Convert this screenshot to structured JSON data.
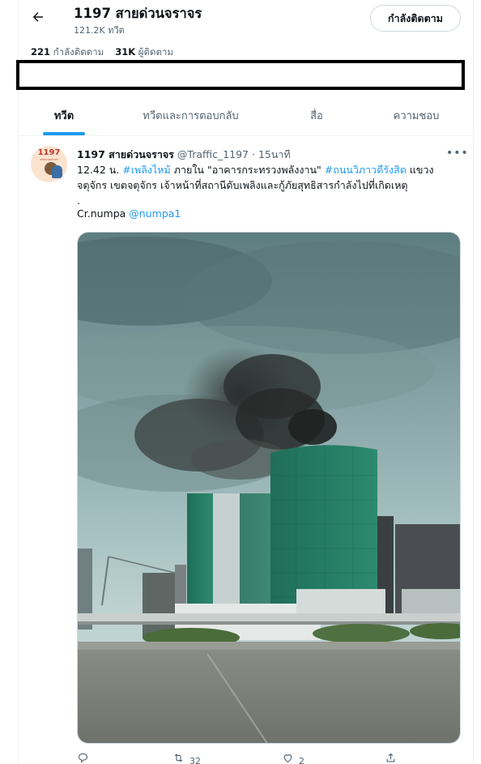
{
  "header": {
    "title": "1197 สายด่วนจราจร",
    "subtitle": "121.2K ทวีต",
    "follow_label": "กำลังติดตาม"
  },
  "stats": {
    "following_count": "221",
    "following_label": "กำลังติดตาม",
    "followers_count": "31K",
    "followers_label": "ผู้ติดตาม"
  },
  "tabs": [
    {
      "label": "ทวีต",
      "active": true
    },
    {
      "label": "ทวีตและการตอบกลับ",
      "active": false
    },
    {
      "label": "สื่อ",
      "active": false
    },
    {
      "label": "ความชอบ",
      "active": false
    }
  ],
  "tweet": {
    "avatar_text": "1197",
    "avatar_subtext": "สายด่วนจราจร",
    "name": "1197 สายด่วนจราจร",
    "handle": "@Traffic_1197",
    "separator": "·",
    "time": "15นาที",
    "more_icon": "more-horizontal-icon",
    "text_line1_prefix": "12.42 น. ",
    "hashtag1": "#เพลิงไหม้",
    "text_line1_mid": " ภายใน \"อาคารกระทรวงพลังงาน\" ",
    "hashtag2": "#ถนนวิภาวดีรังสิต",
    "text_line1_suffix": " แขวง",
    "text_line2": "จตุจักร เขตจตุจักร เจ้าหน้าที่สถานีดับเพลิงและกู้ภัยสุทธิสารกำลังไปที่เกิดเหตุ",
    "text_line3": ".",
    "credit_prefix": "Cr.numpa ",
    "credit_mention": "@numpa1",
    "reply_count": "",
    "retweet_count": "32",
    "like_count": "2"
  },
  "colors": {
    "accent": "#1d9bf0",
    "text_primary": "#0f1419",
    "text_secondary": "#536471",
    "border": "#cfd9de"
  }
}
